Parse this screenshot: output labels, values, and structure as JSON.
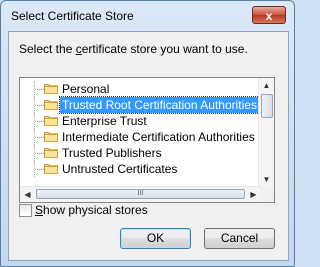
{
  "window": {
    "title": "Select Certificate Store",
    "close_label": "x"
  },
  "prompt": {
    "before": "Select the ",
    "mnemonic": "c",
    "after": "ertificate store you want to use."
  },
  "stores": [
    {
      "label": "Personal",
      "selected": false
    },
    {
      "label": "Trusted Root Certification Authorities",
      "selected": true
    },
    {
      "label": "Enterprise Trust",
      "selected": false
    },
    {
      "label": "Intermediate Certification Authorities",
      "selected": false
    },
    {
      "label": "Trusted Publishers",
      "selected": false
    },
    {
      "label": "Untrusted Certificates",
      "selected": false
    }
  ],
  "scrollbar": {
    "up": "▲",
    "down": "▼",
    "left": "◀",
    "right": "▶",
    "grip": "III"
  },
  "checkbox": {
    "mnemonic": "S",
    "rest": "how physical stores",
    "checked": false
  },
  "buttons": {
    "ok": "OK",
    "cancel": "Cancel"
  }
}
